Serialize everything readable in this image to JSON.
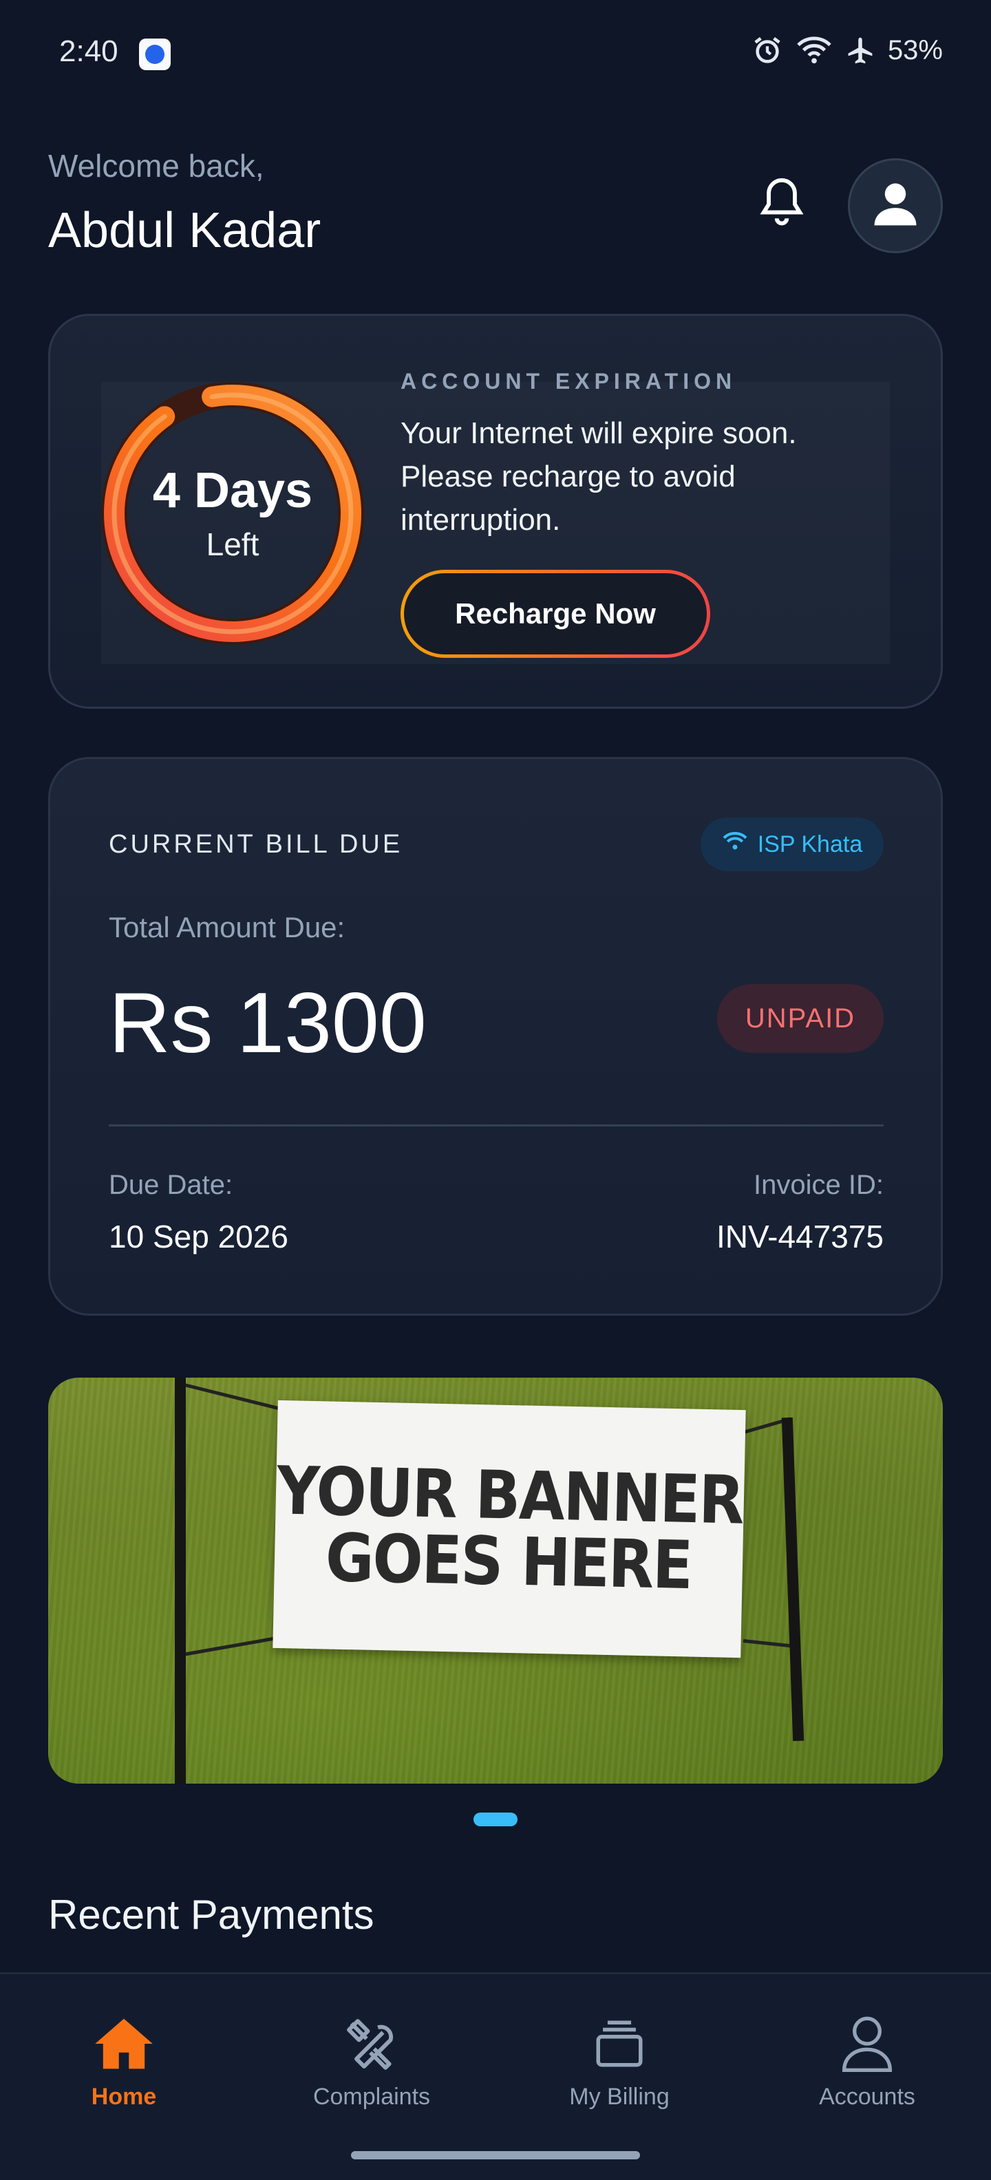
{
  "status_bar": {
    "time": "2:40",
    "battery": "53%",
    "icons": [
      "alarm-icon",
      "wifi-icon",
      "airplane-icon"
    ]
  },
  "header": {
    "welcome": "Welcome back,",
    "user_name": "Abdul Kadar"
  },
  "expiration": {
    "days": "4 Days",
    "left": "Left",
    "label": "ACCOUNT EXPIRATION",
    "message": "Your Internet will expire soon. Please recharge to avoid interruption.",
    "button": "Recharge Now",
    "ring_fraction": 0.93
  },
  "bill": {
    "label": "CURRENT BILL DUE",
    "badge": "ISP Khata",
    "total_label": "Total Amount Due:",
    "amount": "Rs 1300",
    "status": "UNPAID",
    "due_label": "Due Date:",
    "due_value": "10 Sep 2026",
    "invoice_label": "Invoice ID:",
    "invoice_value": "INV-447375"
  },
  "banner": {
    "line1": "YOUR BANNER",
    "line2": "GOES HERE"
  },
  "recent": {
    "title": "Recent Payments"
  },
  "nav": {
    "items": [
      {
        "label": "Home",
        "icon": "home-icon"
      },
      {
        "label": "Complaints",
        "icon": "tools-icon"
      },
      {
        "label": "My Billing",
        "icon": "billing-icon"
      },
      {
        "label": "Accounts",
        "icon": "user-icon"
      }
    ],
    "active": "Home"
  },
  "colors": {
    "background": "#0e1628",
    "accent": "#f97316",
    "info": "#38bdf8",
    "danger": "#f87171"
  }
}
